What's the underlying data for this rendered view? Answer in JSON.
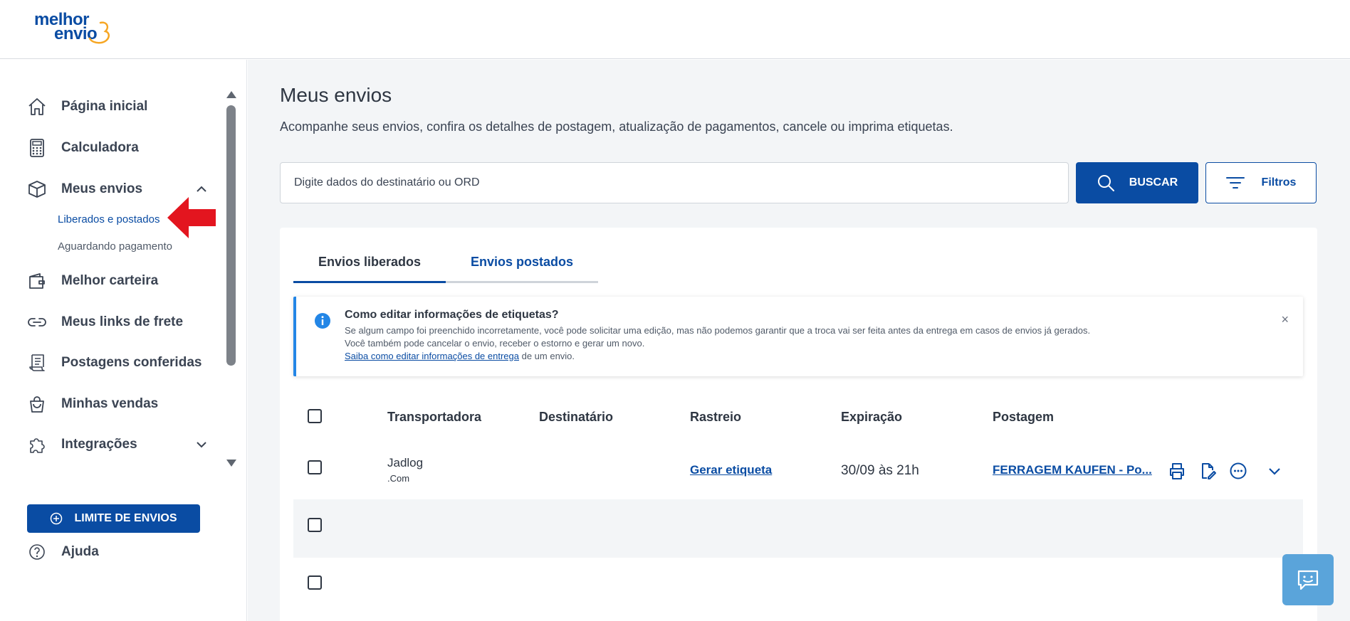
{
  "brand": {
    "logo_line1": "melhor",
    "logo_line2": "envio",
    "primary": "#0a4ca3",
    "accent_orange": "#f6a623"
  },
  "sidebar": {
    "items": [
      {
        "label": "Página inicial",
        "icon": "home-icon"
      },
      {
        "label": "Calculadora",
        "icon": "calculator-icon"
      },
      {
        "label": "Meus envios",
        "icon": "box-icon",
        "expanded": true
      },
      {
        "label": "Melhor carteira",
        "icon": "wallet-icon"
      },
      {
        "label": "Meus links de frete",
        "icon": "link-icon"
      },
      {
        "label": "Postagens conferidas",
        "icon": "receipt-icon"
      },
      {
        "label": "Minhas vendas",
        "icon": "shopping-bag-icon"
      },
      {
        "label": "Integrações",
        "icon": "puzzle-icon",
        "expanded": false
      }
    ],
    "sub_items": [
      {
        "label": "Liberados e postados",
        "active": true
      },
      {
        "label": "Aguardando pagamento",
        "active": false
      }
    ],
    "limit_button": "LIMITE DE ENVIOS",
    "help": "Ajuda"
  },
  "main": {
    "title": "Meus envios",
    "subtitle": "Acompanhe seus envios, confira os detalhes de postagem, atualização de pagamentos, cancele ou imprima etiquetas.",
    "search": {
      "placeholder": "Digite dados do destinatário ou ORD",
      "value": ""
    },
    "search_button": "BUSCAR",
    "filters_button": "Filtros",
    "tabs": [
      {
        "label": "Envios liberados",
        "active": true
      },
      {
        "label": "Envios postados",
        "active": false
      }
    ],
    "info": {
      "title": "Como editar informações de etiquetas?",
      "line1": "Se algum campo foi preenchido incorretamente, você pode solicitar uma edição, mas não podemos garantir que a troca vai ser feita antes da entrega em casos de envios já gerados.",
      "line2": "Você também pode cancelar o envio, receber o estorno e gerar um novo.",
      "link": "Saiba como editar informações de entrega",
      "line3_tail": " de um envio.",
      "close": "×"
    },
    "table": {
      "headers": [
        "Transportadora",
        "Destinatário",
        "Rastreio",
        "Expiração",
        "Postagem"
      ],
      "rows": [
        {
          "carrier": "Jadlog",
          "carrier_sub": ".Com",
          "recipient": "",
          "tracking": "Gerar etiqueta",
          "expiration": "30/09 às 21h",
          "posting": "FERRAGEM KAUFEN - Po..."
        }
      ]
    }
  }
}
